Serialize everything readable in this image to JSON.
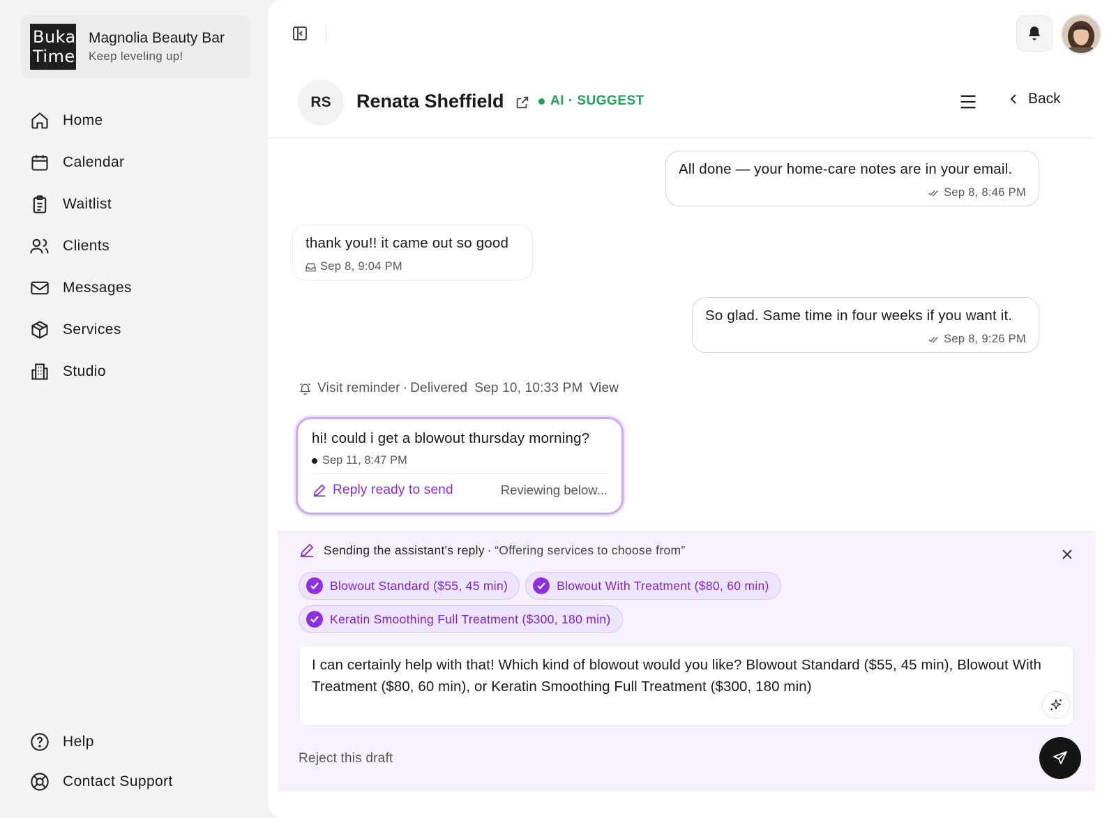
{
  "brand": {
    "logo_line1": "Buka",
    "logo_line2": "Time",
    "name": "Magnolia Beauty Bar",
    "tagline": "Keep leveling up!"
  },
  "nav": {
    "items": [
      {
        "label": "Home",
        "icon": "home-icon"
      },
      {
        "label": "Calendar",
        "icon": "calendar-icon"
      },
      {
        "label": "Waitlist",
        "icon": "clipboard-icon"
      },
      {
        "label": "Clients",
        "icon": "users-icon"
      },
      {
        "label": "Messages",
        "icon": "mail-icon"
      },
      {
        "label": "Services",
        "icon": "box-icon"
      },
      {
        "label": "Studio",
        "icon": "building-icon"
      }
    ],
    "bottom": [
      {
        "label": "Help",
        "icon": "help-circle-icon"
      },
      {
        "label": "Contact Support",
        "icon": "lifebuoy-icon"
      }
    ]
  },
  "conversation": {
    "initials": "RS",
    "name": "Renata Sheffield",
    "ai_status": "AI · SUGGEST",
    "back_label": "Back",
    "colors": {
      "ai_green": "#1fa35a",
      "accent_purple": "#8c2fe0"
    }
  },
  "messages": [
    {
      "direction": "out",
      "text": "All done — your home-care notes are in your email.",
      "time": "Sep 8, 8:46 PM"
    },
    {
      "direction": "in",
      "text": "thank you!! it came out so good",
      "time": "Sep 8, 9:04 PM"
    },
    {
      "direction": "out",
      "text": "So glad. Same time in four weeks if you want it.",
      "time": "Sep 8, 9:26 PM"
    }
  ],
  "reminder": {
    "label": "Visit reminder",
    "status": "Delivered",
    "time": "Sep 10, 10:33 PM",
    "view_label": "View"
  },
  "latest": {
    "text": "hi! could i get a blowout thursday morning?",
    "time": "Sep 11, 8:47 PM",
    "reply_ready": "Reply ready to send",
    "reviewing": "Reviewing below..."
  },
  "draft": {
    "heading": "Sending the assistant's reply",
    "subheading": "“Offering services to choose from”",
    "chips": [
      "Blowout Standard ($55, 45 min)",
      "Blowout With Treatment ($80, 60 min)",
      "Keratin Smoothing Full Treatment ($300, 180 min)"
    ],
    "body": "I can certainly help with that! Which kind of blowout would you like? Blowout Standard ($55, 45 min), Blowout With Treatment ($80, 60 min), or Keratin Smoothing Full Treatment ($300, 180 min)",
    "reject_label": "Reject this draft"
  }
}
